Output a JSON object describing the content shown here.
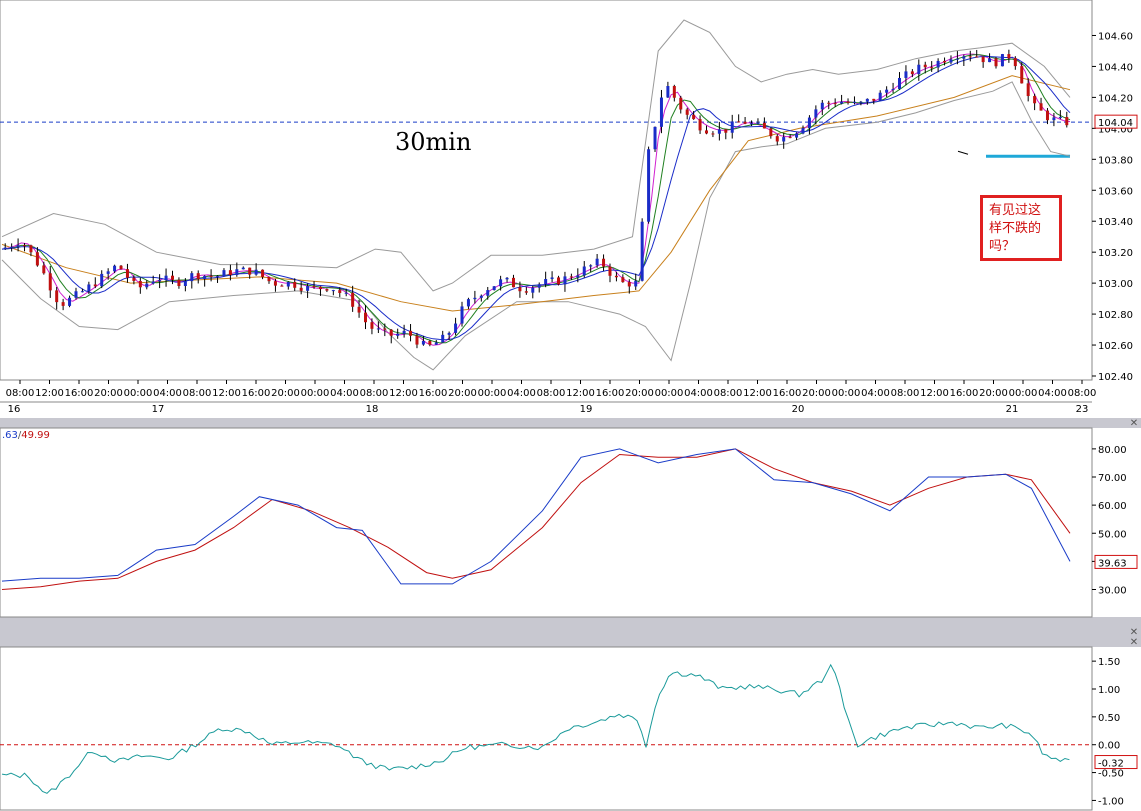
{
  "chart_data": [
    {
      "type": "candlestick",
      "annotation_timeframe": "30min",
      "annotation_note": "有见过这样不跌的吗？",
      "ylim": [
        102.4,
        104.7
      ],
      "y_ticks": [
        "104.60",
        "104.40",
        "104.20",
        "104.00",
        "103.80",
        "103.60",
        "103.40",
        "103.20",
        "103.00",
        "102.80",
        "102.60",
        "102.40"
      ],
      "last_price": "104.04",
      "x_time_ticks": [
        "08:00",
        "12:00",
        "16:00",
        "20:00",
        "00:00",
        "04:00",
        "08:00",
        "12:00",
        "16:00",
        "20:00",
        "00:00",
        "04:00",
        "08:00",
        "12:00",
        "16:00",
        "20:00",
        "00:00",
        "04:00",
        "08:00",
        "12:00",
        "16:00",
        "20:00",
        "00:00",
        "04:00",
        "08:00",
        "12:00",
        "16:00",
        "20:00",
        "00:00",
        "04:00",
        "08:00",
        "12:00",
        "16:00",
        "20:00",
        "00:00",
        "04:00",
        "08:00"
      ],
      "x_day_ticks": [
        "16",
        "17",
        "18",
        "19",
        "20",
        "21",
        "23"
      ],
      "close_path": [
        [
          0,
          103.22
        ],
        [
          3,
          103.28
        ],
        [
          6,
          103.1
        ],
        [
          9,
          102.86
        ],
        [
          12,
          102.93
        ],
        [
          15,
          103.02
        ],
        [
          18,
          103.12
        ],
        [
          21,
          102.96
        ],
        [
          24,
          103.04
        ],
        [
          27,
          103.0
        ],
        [
          30,
          103.06
        ],
        [
          33,
          103.04
        ],
        [
          36,
          103.08
        ],
        [
          39,
          103.08
        ],
        [
          42,
          103.0
        ],
        [
          45,
          103.0
        ],
        [
          48,
          102.96
        ],
        [
          51,
          102.98
        ],
        [
          54,
          102.9
        ],
        [
          57,
          102.72
        ],
        [
          60,
          102.66
        ],
        [
          63,
          102.68
        ],
        [
          66,
          102.58
        ],
        [
          69,
          102.65
        ],
        [
          72,
          102.86
        ],
        [
          75,
          102.96
        ],
        [
          78,
          103.02
        ],
        [
          81,
          102.96
        ],
        [
          84,
          103.0
        ],
        [
          87,
          103.02
        ],
        [
          90,
          103.08
        ],
        [
          93,
          103.14
        ],
        [
          96,
          103.0
        ],
        [
          99,
          103.0
        ],
        [
          100,
          103.75
        ],
        [
          103,
          104.3
        ],
        [
          106,
          104.1
        ],
        [
          109,
          104.0
        ],
        [
          112,
          103.98
        ],
        [
          115,
          104.05
        ],
        [
          118,
          104.0
        ],
        [
          121,
          103.93
        ],
        [
          124,
          104.0
        ],
        [
          127,
          104.15
        ],
        [
          130,
          104.18
        ],
        [
          133,
          104.15
        ],
        [
          136,
          104.2
        ],
        [
          139,
          104.3
        ],
        [
          142,
          104.38
        ],
        [
          145,
          104.42
        ],
        [
          148,
          104.48
        ],
        [
          151,
          104.48
        ],
        [
          154,
          104.42
        ],
        [
          157,
          104.48
        ],
        [
          160,
          104.15
        ],
        [
          163,
          104.06
        ],
        [
          165,
          104.04
        ]
      ],
      "upper_band": [
        [
          0,
          103.3
        ],
        [
          8,
          103.45
        ],
        [
          16,
          103.38
        ],
        [
          24,
          103.2
        ],
        [
          34,
          103.12
        ],
        [
          42,
          103.12
        ],
        [
          52,
          103.1
        ],
        [
          58,
          103.22
        ],
        [
          62,
          103.2
        ],
        [
          67,
          102.95
        ],
        [
          70,
          103.0
        ],
        [
          76,
          103.18
        ],
        [
          84,
          103.18
        ],
        [
          92,
          103.22
        ],
        [
          98,
          103.3
        ],
        [
          102,
          104.5
        ],
        [
          106,
          104.7
        ],
        [
          110,
          104.62
        ],
        [
          114,
          104.4
        ],
        [
          118,
          104.3
        ],
        [
          122,
          104.35
        ],
        [
          126,
          104.38
        ],
        [
          130,
          104.35
        ],
        [
          136,
          104.38
        ],
        [
          142,
          104.45
        ],
        [
          148,
          104.5
        ],
        [
          152,
          104.52
        ],
        [
          157,
          104.55
        ],
        [
          162,
          104.4
        ],
        [
          166,
          104.2
        ]
      ],
      "lower_band": [
        [
          0,
          103.15
        ],
        [
          6,
          102.9
        ],
        [
          12,
          102.72
        ],
        [
          18,
          102.7
        ],
        [
          26,
          102.88
        ],
        [
          36,
          102.92
        ],
        [
          46,
          102.95
        ],
        [
          56,
          102.88
        ],
        [
          60,
          102.68
        ],
        [
          64,
          102.52
        ],
        [
          67,
          102.44
        ],
        [
          72,
          102.66
        ],
        [
          80,
          102.88
        ],
        [
          88,
          102.88
        ],
        [
          96,
          102.8
        ],
        [
          100,
          102.72
        ],
        [
          104,
          102.5
        ],
        [
          107,
          103.0
        ],
        [
          110,
          103.55
        ],
        [
          114,
          103.85
        ],
        [
          118,
          103.88
        ],
        [
          122,
          103.9
        ],
        [
          128,
          104.0
        ],
        [
          136,
          104.04
        ],
        [
          142,
          104.1
        ],
        [
          148,
          104.18
        ],
        [
          154,
          104.24
        ],
        [
          157,
          104.3
        ],
        [
          160,
          104.05
        ],
        [
          163,
          103.85
        ],
        [
          166,
          103.82
        ]
      ],
      "ema_slow": [
        [
          0,
          103.25
        ],
        [
          10,
          103.1
        ],
        [
          20,
          103.0
        ],
        [
          30,
          103.02
        ],
        [
          40,
          103.04
        ],
        [
          52,
          103.0
        ],
        [
          62,
          102.88
        ],
        [
          70,
          102.82
        ],
        [
          80,
          102.86
        ],
        [
          92,
          102.92
        ],
        [
          99,
          102.95
        ],
        [
          104,
          103.2
        ],
        [
          110,
          103.6
        ],
        [
          116,
          103.92
        ],
        [
          124,
          104.0
        ],
        [
          136,
          104.08
        ],
        [
          148,
          104.2
        ],
        [
          157,
          104.34
        ],
        [
          166,
          104.25
        ]
      ],
      "level_line": 104.04,
      "support_level": 103.82
    },
    {
      "type": "line",
      "header_value_1": ".63",
      "header_value_2": "49.99",
      "ylim": [
        22,
        86
      ],
      "y_ticks": [
        "80.00",
        "70.00",
        "60.00",
        "50.00",
        "40.00",
        "30.00"
      ],
      "last_value_label": "39.63",
      "series": [
        {
          "values": [
            [
              0,
              33
            ],
            [
              6,
              34
            ],
            [
              12,
              34
            ],
            [
              18,
              35
            ],
            [
              24,
              44
            ],
            [
              30,
              46
            ],
            [
              36,
              56
            ],
            [
              40,
              63
            ],
            [
              46,
              60
            ],
            [
              52,
              52
            ],
            [
              56,
              51
            ],
            [
              62,
              32
            ],
            [
              70,
              32
            ],
            [
              76,
              40
            ],
            [
              84,
              58
            ],
            [
              90,
              77
            ],
            [
              96,
              80
            ],
            [
              102,
              75
            ],
            [
              108,
              78
            ],
            [
              114,
              80
            ],
            [
              120,
              69
            ],
            [
              126,
              68
            ],
            [
              132,
              64
            ],
            [
              138,
              58
            ],
            [
              144,
              70
            ],
            [
              150,
              70
            ],
            [
              156,
              71
            ],
            [
              160,
              66
            ],
            [
              166,
              40
            ]
          ]
        },
        {
          "values": [
            [
              0,
              30
            ],
            [
              6,
              31
            ],
            [
              12,
              33
            ],
            [
              18,
              34
            ],
            [
              24,
              40
            ],
            [
              30,
              44
            ],
            [
              36,
              52
            ],
            [
              42,
              62
            ],
            [
              48,
              58
            ],
            [
              54,
              52
            ],
            [
              60,
              45
            ],
            [
              66,
              36
            ],
            [
              70,
              34
            ],
            [
              76,
              37
            ],
            [
              84,
              52
            ],
            [
              90,
              68
            ],
            [
              96,
              78
            ],
            [
              102,
              77
            ],
            [
              108,
              77
            ],
            [
              114,
              80
            ],
            [
              120,
              73
            ],
            [
              126,
              68
            ],
            [
              132,
              65
            ],
            [
              138,
              60
            ],
            [
              144,
              66
            ],
            [
              150,
              70
            ],
            [
              156,
              71
            ],
            [
              160,
              69
            ],
            [
              166,
              50
            ]
          ]
        }
      ]
    },
    {
      "type": "line",
      "ylim": [
        -1.1,
        1.7
      ],
      "y_ticks": [
        "1.50",
        "1.00",
        "0.50",
        "0.00",
        "-0.50",
        "-1.00"
      ],
      "last_value_label": "-0.32",
      "series": [
        {
          "values": [
            [
              0,
              -0.55
            ],
            [
              4,
              -0.55
            ],
            [
              7,
              -0.9
            ],
            [
              10,
              -0.6
            ],
            [
              14,
              -0.1
            ],
            [
              18,
              -0.3
            ],
            [
              22,
              -0.2
            ],
            [
              26,
              -0.25
            ],
            [
              30,
              0.0
            ],
            [
              34,
              0.3
            ],
            [
              38,
              0.25
            ],
            [
              42,
              0.0
            ],
            [
              46,
              0.05
            ],
            [
              52,
              0.0
            ],
            [
              56,
              -0.3
            ],
            [
              60,
              -0.45
            ],
            [
              64,
              -0.4
            ],
            [
              68,
              -0.3
            ],
            [
              72,
              -0.05
            ],
            [
              78,
              0.0
            ],
            [
              84,
              -0.05
            ],
            [
              88,
              0.3
            ],
            [
              92,
              0.4
            ],
            [
              96,
              0.55
            ],
            [
              99,
              0.45
            ],
            [
              100,
              -0.05
            ],
            [
              102,
              0.9
            ],
            [
              104,
              1.3
            ],
            [
              108,
              1.25
            ],
            [
              112,
              1.0
            ],
            [
              116,
              1.05
            ],
            [
              120,
              1.0
            ],
            [
              124,
              0.9
            ],
            [
              128,
              1.2
            ],
            [
              129,
              1.55
            ],
            [
              131,
              0.6
            ],
            [
              133,
              0.0
            ],
            [
              136,
              0.15
            ],
            [
              140,
              0.3
            ],
            [
              144,
              0.35
            ],
            [
              148,
              0.4
            ],
            [
              152,
              0.3
            ],
            [
              156,
              0.35
            ],
            [
              160,
              0.2
            ],
            [
              162,
              -0.2
            ],
            [
              166,
              -0.32
            ]
          ]
        }
      ]
    }
  ]
}
